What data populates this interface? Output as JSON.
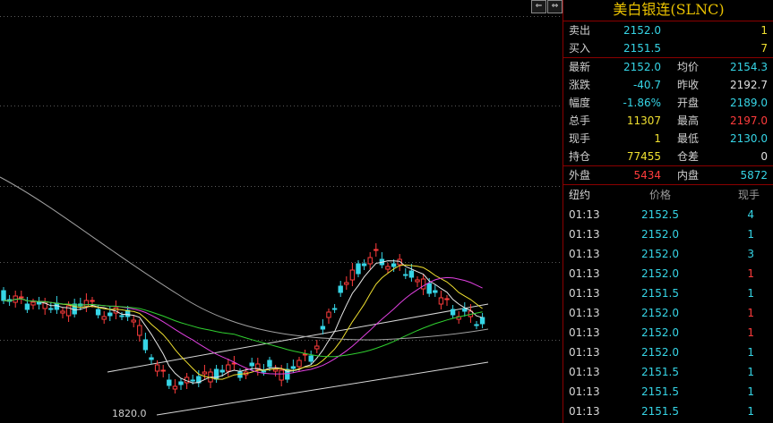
{
  "chart": {
    "low_label": "1820.0",
    "buttons": [
      "⇐",
      "⇔"
    ]
  },
  "quote": {
    "title": "美白银连(SLNC)",
    "ask": {
      "label": "卖出",
      "price": "2152.0",
      "qty": "1"
    },
    "bid": {
      "label": "买入",
      "price": "2151.5",
      "qty": "7"
    },
    "rows": [
      {
        "l1": "最新",
        "v1": "2152.0",
        "c1": "cyan",
        "l2": "均价",
        "v2": "2154.3",
        "c2": "cyan"
      },
      {
        "l1": "涨跌",
        "v1": "-40.7",
        "c1": "cyan",
        "l2": "昨收",
        "v2": "2192.7",
        "c2": "white"
      },
      {
        "l1": "幅度",
        "v1": "-1.86%",
        "c1": "cyan",
        "l2": "开盘",
        "v2": "2189.0",
        "c2": "cyan"
      },
      {
        "l1": "总手",
        "v1": "11307",
        "c1": "yellow",
        "l2": "最高",
        "v2": "2197.0",
        "c2": "red"
      },
      {
        "l1": "现手",
        "v1": "1",
        "c1": "yellow",
        "l2": "最低",
        "v2": "2130.0",
        "c2": "cyan"
      },
      {
        "l1": "持仓",
        "v1": "77455",
        "c1": "yellow",
        "l2": "仓差",
        "v2": "0",
        "c2": "white"
      }
    ],
    "outer": {
      "label": "外盘",
      "value": "5434"
    },
    "inner": {
      "label": "内盘",
      "value": "5872"
    }
  },
  "ticks": {
    "headers": [
      "纽约",
      "价格",
      "现手"
    ],
    "rows": [
      {
        "time": "01:13",
        "price": "2152.5",
        "vol": "4",
        "color": "cyan"
      },
      {
        "time": "01:13",
        "price": "2152.0",
        "vol": "1",
        "color": "cyan"
      },
      {
        "time": "01:13",
        "price": "2152.0",
        "vol": "3",
        "color": "cyan"
      },
      {
        "time": "01:13",
        "price": "2152.0",
        "vol": "1",
        "color": "red"
      },
      {
        "time": "01:13",
        "price": "2151.5",
        "vol": "1",
        "color": "cyan"
      },
      {
        "time": "01:13",
        "price": "2152.0",
        "vol": "1",
        "color": "red"
      },
      {
        "time": "01:13",
        "price": "2152.0",
        "vol": "1",
        "color": "red"
      },
      {
        "time": "01:13",
        "price": "2152.0",
        "vol": "1",
        "color": "cyan"
      },
      {
        "time": "01:13",
        "price": "2151.5",
        "vol": "1",
        "color": "cyan"
      },
      {
        "time": "01:13",
        "price": "2151.5",
        "vol": "1",
        "color": "cyan"
      },
      {
        "time": "01:13",
        "price": "2151.5",
        "vol": "1",
        "color": "cyan"
      }
    ]
  },
  "colors": {
    "up": "#ff3c3c",
    "down": "#36d5e6",
    "title": "#e8c000",
    "divider": "#8b0000"
  }
}
